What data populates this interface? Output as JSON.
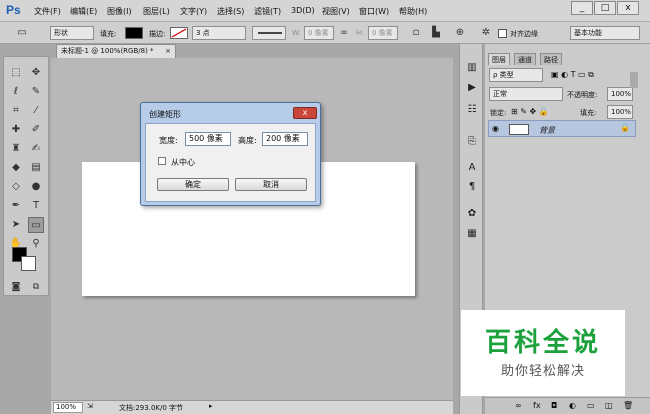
{
  "app": {
    "logo": "Ps",
    "menu": [
      "文件(F)",
      "编辑(E)",
      "图像(I)",
      "图层(L)",
      "文字(Y)",
      "选择(S)",
      "滤镜(T)",
      "3D(D)",
      "视图(V)",
      "窗口(W)",
      "帮助(H)"
    ],
    "window_controls": [
      "_",
      "□",
      "x"
    ]
  },
  "options_bar": {
    "mode": "形状",
    "fill_label": "填充:",
    "stroke_label": "描边:",
    "stroke_size": "3 点",
    "w_label": "W:",
    "w_value": "0 像素",
    "h_label": "H:",
    "h_value": "0 像素",
    "align_edges": "对齐边缘",
    "workspace": "基本功能"
  },
  "document": {
    "tab_title": "未标题-1 @ 100%(RGB/8) *",
    "tab_close": "×",
    "zoom": "100%",
    "doc_info": "文档:293.0K/0 字节"
  },
  "dialog": {
    "title": "创建矩形",
    "close": "x",
    "width_label": "宽度:",
    "width_value": "500 像素",
    "height_label": "高度:",
    "height_value": "200 像素",
    "from_center_label": "从中心",
    "ok": "确定",
    "cancel": "取消"
  },
  "layers_panel": {
    "tabs": [
      "图层",
      "通道",
      "路径"
    ],
    "filter_kind": "ρ 类型",
    "blend_mode": "正常",
    "opacity_label": "不透明度:",
    "opacity_value": "100%",
    "lock_label": "锁定:",
    "fill_label": "填充:",
    "fill_value": "100%",
    "layer_name": "背景",
    "bottom_icons": [
      "link-icon",
      "fx-icon",
      "mask-icon",
      "adjustment-icon",
      "folder-icon",
      "new-layer-icon",
      "trash-icon"
    ]
  },
  "watermark": {
    "title": "百科全说",
    "subtitle": "助你轻松解决"
  },
  "colors": {
    "accent_logo": "#1d5fae",
    "watermark_green": "#1ca13c",
    "dialog_frame": "#b7cce8",
    "layer_selected": "#b7c6df"
  }
}
